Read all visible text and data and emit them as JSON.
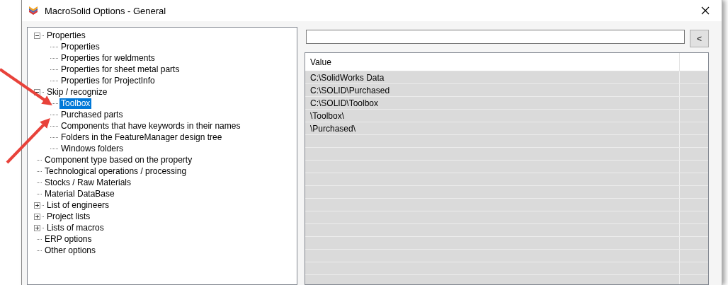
{
  "window": {
    "title": "MacroSolid Options - General"
  },
  "tree": [
    {
      "label": "Properties",
      "expanded": true,
      "selected": false,
      "children": [
        {
          "label": "Properties",
          "selected": false
        },
        {
          "label": "Properties for weldments",
          "selected": false
        },
        {
          "label": "Properties for sheet metal parts",
          "selected": false
        },
        {
          "label": "Properties for ProjectInfo",
          "selected": false
        }
      ]
    },
    {
      "label": "Skip / recognize",
      "expanded": true,
      "selected": false,
      "children": [
        {
          "label": "Toolbox",
          "selected": true
        },
        {
          "label": "Purchased parts",
          "selected": false
        },
        {
          "label": "Components that have keywords in their names",
          "selected": false
        },
        {
          "label": "Folders in the FeatureManager design tree",
          "selected": false
        },
        {
          "label": "Windows folders",
          "selected": false
        }
      ]
    },
    {
      "label": "Component type based on the property",
      "selected": false
    },
    {
      "label": "Technological operations / processing",
      "selected": false
    },
    {
      "label": "Stocks / Raw Materials",
      "selected": false
    },
    {
      "label": "Material DataBase",
      "selected": false
    },
    {
      "label": "List of engineers",
      "expanded": false,
      "selected": false
    },
    {
      "label": "Project lists",
      "expanded": false,
      "selected": false
    },
    {
      "label": "Lists of macros",
      "expanded": false,
      "selected": false
    },
    {
      "label": "ERP options",
      "selected": false
    },
    {
      "label": "Other options",
      "selected": false
    }
  ],
  "back_button": {
    "label": "<"
  },
  "table": {
    "columns": [
      "Value"
    ],
    "rows": [
      "C:\\SolidWorks Data",
      "C:\\SOLID\\Purchased",
      "C:\\SOLID\\Toolbox",
      "\\Toolbox\\",
      "\\Purchased\\"
    ]
  }
}
